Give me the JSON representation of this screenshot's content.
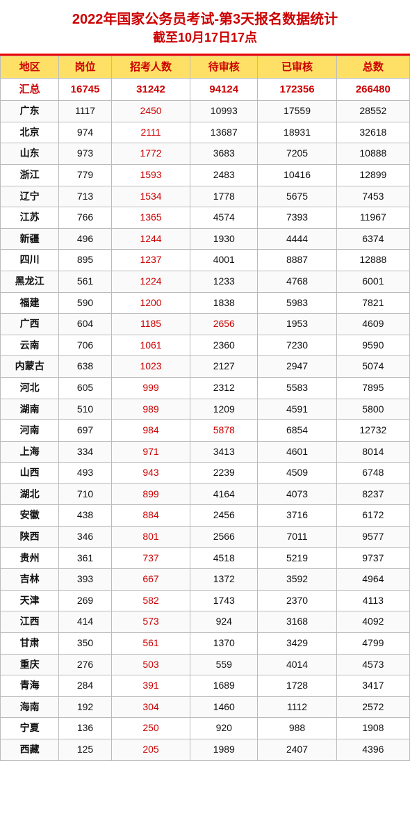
{
  "title": {
    "line1": "2022年国家公务员考试-第3天报名数据统计",
    "line2": "截至10月17日17点"
  },
  "columns": [
    "地区",
    "岗位",
    "招考人数",
    "待审核",
    "已审核",
    "总数"
  ],
  "summary": {
    "region": "汇总",
    "岗位": "16745",
    "招考人数": "31242",
    "待审核": "94124",
    "已审核": "172356",
    "总数": "266480"
  },
  "rows": [
    {
      "region": "广东",
      "岗位": "1117",
      "招考人数": "2450",
      "待审核": "10993",
      "已审核": "17559",
      "总数": "28552"
    },
    {
      "region": "北京",
      "岗位": "974",
      "招考人数": "2111",
      "待审核": "13687",
      "已审核": "18931",
      "总数": "32618"
    },
    {
      "region": "山东",
      "岗位": "973",
      "招考人数": "1772",
      "待审核": "3683",
      "已审核": "7205",
      "总数": "10888"
    },
    {
      "region": "浙江",
      "岗位": "779",
      "招考人数": "1593",
      "待审核": "2483",
      "已审核": "10416",
      "总数": "12899"
    },
    {
      "region": "辽宁",
      "岗位": "713",
      "招考人数": "1534",
      "待审核": "1778",
      "已审核": "5675",
      "总数": "7453"
    },
    {
      "region": "江苏",
      "岗位": "766",
      "招考人数": "1365",
      "待审核": "4574",
      "已审核": "7393",
      "总数": "11967"
    },
    {
      "region": "新疆",
      "岗位": "496",
      "招考人数": "1244",
      "待审核": "1930",
      "已审核": "4444",
      "总数": "6374"
    },
    {
      "region": "四川",
      "岗位": "895",
      "招考人数": "1237",
      "待审核": "4001",
      "已审核": "8887",
      "总数": "12888"
    },
    {
      "region": "黑龙江",
      "岗位": "561",
      "招考人数": "1224",
      "待审核": "1233",
      "已审核": "4768",
      "总数": "6001"
    },
    {
      "region": "福建",
      "岗位": "590",
      "招考人数": "1200",
      "待审核": "1838",
      "已审核": "5983",
      "总数": "7821"
    },
    {
      "region": "广西",
      "岗位": "604",
      "招考人数": "1185",
      "待审核": "2656",
      "已审核": "1953",
      "总数": "4609"
    },
    {
      "region": "云南",
      "岗位": "706",
      "招考人数": "1061",
      "待审核": "2360",
      "已审核": "7230",
      "总数": "9590"
    },
    {
      "region": "内蒙古",
      "岗位": "638",
      "招考人数": "1023",
      "待审核": "2127",
      "已审核": "2947",
      "总数": "5074"
    },
    {
      "region": "河北",
      "岗位": "605",
      "招考人数": "999",
      "待审核": "2312",
      "已审核": "5583",
      "总数": "7895"
    },
    {
      "region": "湖南",
      "岗位": "510",
      "招考人数": "989",
      "待审核": "1209",
      "已审核": "4591",
      "总数": "5800"
    },
    {
      "region": "河南",
      "岗位": "697",
      "招考人数": "984",
      "待审核": "5878",
      "已审核": "6854",
      "总数": "12732"
    },
    {
      "region": "上海",
      "岗位": "334",
      "招考人数": "971",
      "待审核": "3413",
      "已审核": "4601",
      "总数": "8014"
    },
    {
      "region": "山西",
      "岗位": "493",
      "招考人数": "943",
      "待审核": "2239",
      "已审核": "4509",
      "总数": "6748"
    },
    {
      "region": "湖北",
      "岗位": "710",
      "招考人数": "899",
      "待审核": "4164",
      "已审核": "4073",
      "总数": "8237"
    },
    {
      "region": "安徽",
      "岗位": "438",
      "招考人数": "884",
      "待审核": "2456",
      "已审核": "3716",
      "总数": "6172"
    },
    {
      "region": "陕西",
      "岗位": "346",
      "招考人数": "801",
      "待审核": "2566",
      "已审核": "7011",
      "总数": "9577"
    },
    {
      "region": "贵州",
      "岗位": "361",
      "招考人数": "737",
      "待审核": "4518",
      "已审核": "5219",
      "总数": "9737"
    },
    {
      "region": "吉林",
      "岗位": "393",
      "招考人数": "667",
      "待审核": "1372",
      "已审核": "3592",
      "总数": "4964"
    },
    {
      "region": "天津",
      "岗位": "269",
      "招考人数": "582",
      "待审核": "1743",
      "已审核": "2370",
      "总数": "4113"
    },
    {
      "region": "江西",
      "岗位": "414",
      "招考人数": "573",
      "待审核": "924",
      "已审核": "3168",
      "总数": "4092"
    },
    {
      "region": "甘肃",
      "岗位": "350",
      "招考人数": "561",
      "待审核": "1370",
      "已审核": "3429",
      "总数": "4799"
    },
    {
      "region": "重庆",
      "岗位": "276",
      "招考人数": "503",
      "待审核": "559",
      "已审核": "4014",
      "总数": "4573"
    },
    {
      "region": "青海",
      "岗位": "284",
      "招考人数": "391",
      "待审核": "1689",
      "已审核": "1728",
      "总数": "3417"
    },
    {
      "region": "海南",
      "岗位": "192",
      "招考人数": "304",
      "待审核": "1460",
      "已审核": "1112",
      "总数": "2572"
    },
    {
      "region": "宁夏",
      "岗位": "136",
      "招考人数": "250",
      "待审核": "920",
      "已审核": "988",
      "总数": "1908"
    },
    {
      "region": "西藏",
      "岗位": "125",
      "招考人数": "205",
      "待审核": "1989",
      "已审核": "2407",
      "总数": "4396"
    }
  ]
}
